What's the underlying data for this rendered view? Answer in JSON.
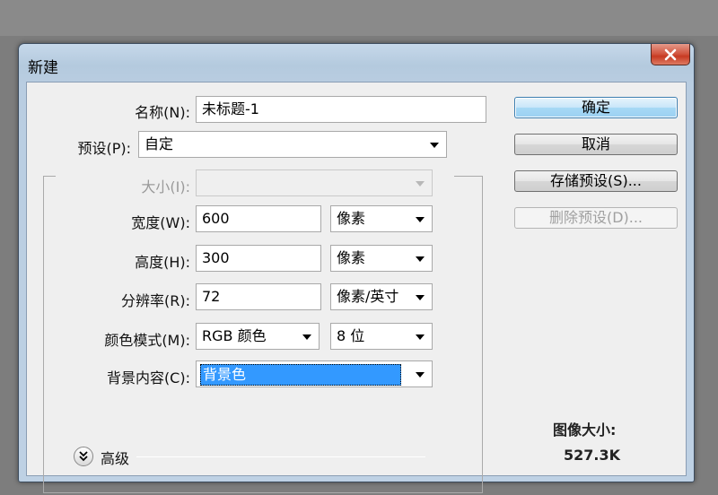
{
  "dialog": {
    "title": "新建",
    "name_label": "名称(N):",
    "name_value": "未标题-1",
    "preset_label": "预设(P):",
    "preset_value": "自定",
    "size_label": "大小(I):",
    "size_value": "",
    "width_label": "宽度(W):",
    "width_value": "600",
    "width_unit": "像素",
    "height_label": "高度(H):",
    "height_value": "300",
    "height_unit": "像素",
    "resolution_label": "分辨率(R):",
    "resolution_value": "72",
    "resolution_unit": "像素/英寸",
    "color_mode_label": "颜色模式(M):",
    "color_mode_value": "RGB 颜色",
    "bit_depth_value": "8 位",
    "background_label": "背景内容(C):",
    "background_value": "背景色",
    "advanced_label": "高级",
    "image_size_label": "图像大小:",
    "image_size_value": "527.3K"
  },
  "buttons": {
    "ok": "确定",
    "cancel": "取消",
    "save_preset": "存储预设(S)...",
    "delete_preset": "删除预设(D)..."
  },
  "colors": {
    "selection": "#3399ff",
    "close_button": "#c73a22"
  }
}
